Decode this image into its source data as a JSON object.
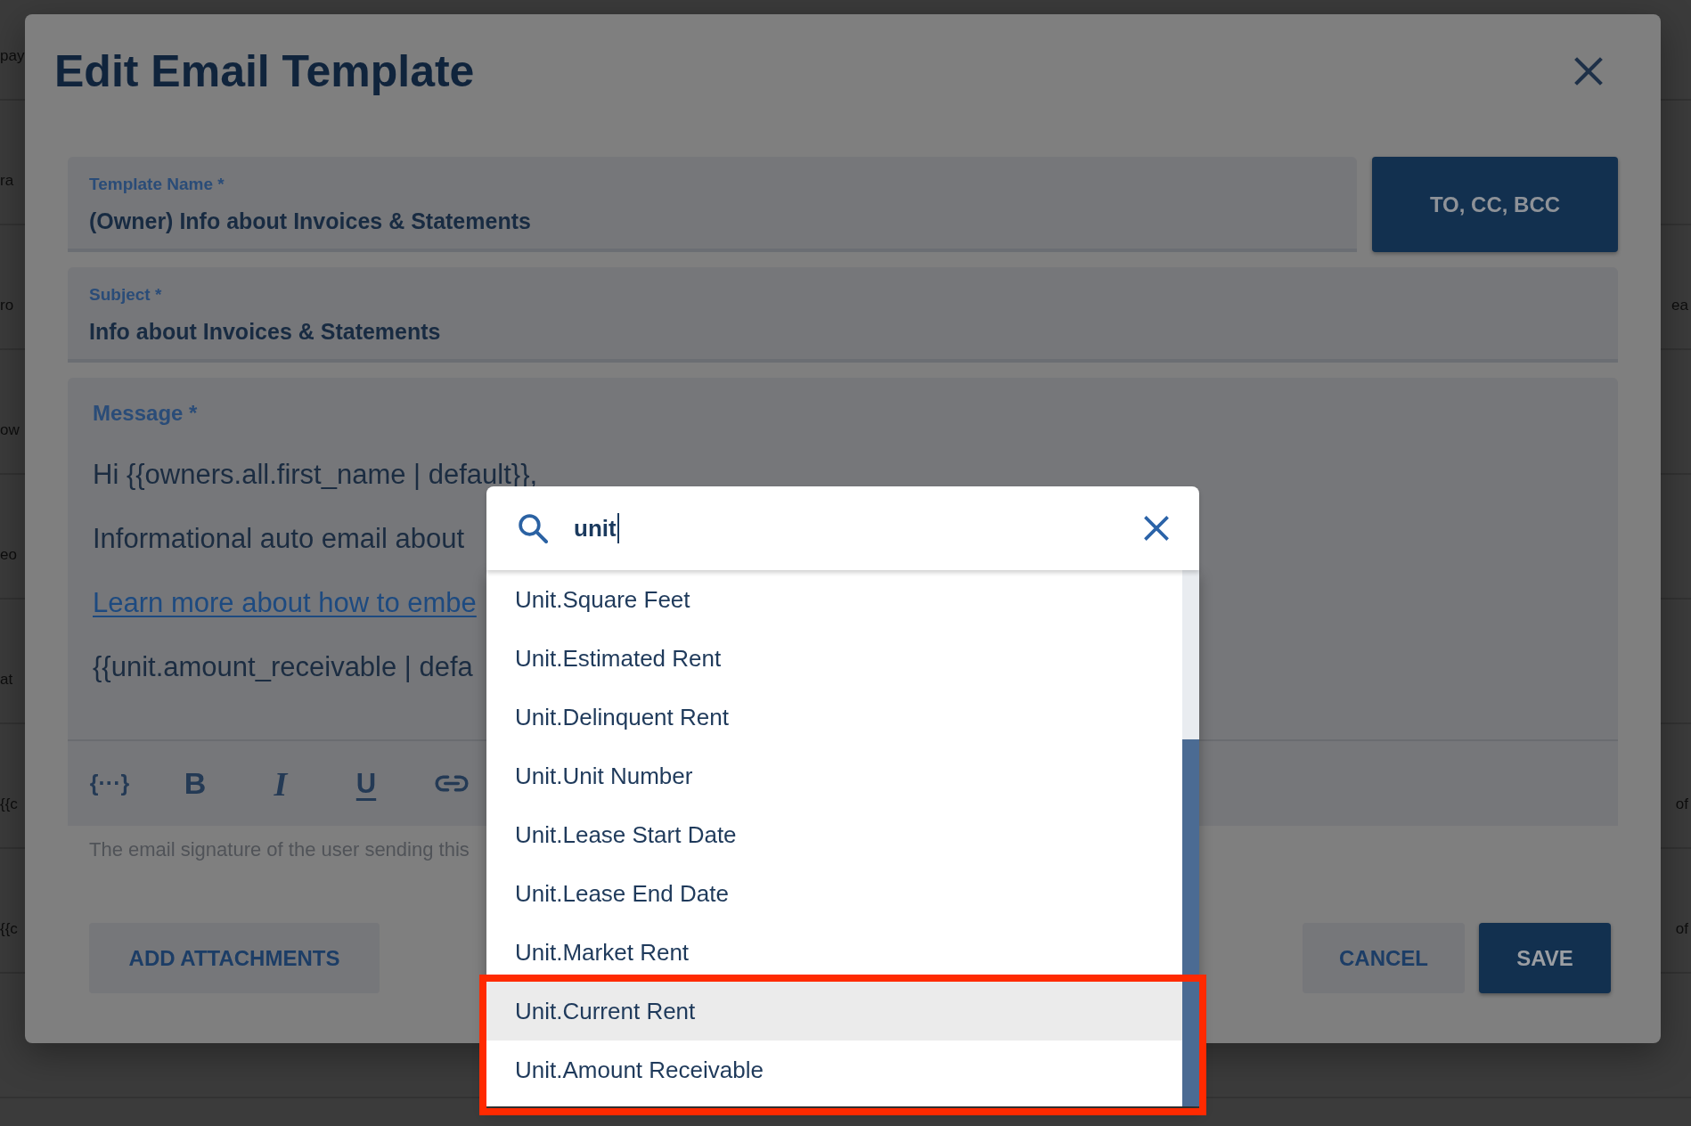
{
  "background_page": {
    "rows": [
      {
        "left_text": "pay"
      },
      {
        "left_text": "ra"
      },
      {
        "left_text": "ro",
        "right_text": "ea"
      },
      {
        "left_text": "ow"
      },
      {
        "left_text": "eo"
      },
      {
        "left_text": "at"
      },
      {
        "left_text": "{{c",
        "right_text": "of"
      },
      {
        "left_text": "{{c",
        "right_text": "of"
      }
    ]
  },
  "dialog": {
    "title": "Edit Email Template",
    "template_name": {
      "label": "Template Name *",
      "value": "(Owner) Info about Invoices & Statements"
    },
    "recipients_button": "TO, CC, BCC",
    "subject": {
      "label": "Subject *",
      "value": "Info about Invoices & Statements"
    },
    "message": {
      "label": "Message *",
      "paragraphs": [
        {
          "kind": "text",
          "text": "Hi {{owners.all.first_name | default}},"
        },
        {
          "kind": "text",
          "text": "Informational auto email about"
        },
        {
          "kind": "link",
          "text": "Learn more about how to embe"
        },
        {
          "kind": "text",
          "text": "{{unit.amount_receivable | defa"
        }
      ],
      "toolbar": [
        {
          "kind": "glyph",
          "label": "{···}"
        },
        {
          "kind": "bold",
          "label": "B"
        },
        {
          "kind": "italic",
          "label": "I"
        },
        {
          "kind": "underline",
          "label": "U"
        },
        {
          "kind": "link"
        }
      ]
    },
    "signature_note": "The email signature of the user sending this",
    "attachments_button": "ADD ATTACHMENTS",
    "actions": [
      {
        "kind": "secondary",
        "label": "CANCEL"
      },
      {
        "kind": "primary",
        "label": "SAVE"
      }
    ]
  },
  "variable_picker": {
    "search": {
      "value": "unit"
    },
    "items": [
      {
        "label": "Unit.Square Feet",
        "selected": false,
        "framed": false
      },
      {
        "label": "Unit.Estimated Rent",
        "selected": false,
        "framed": false
      },
      {
        "label": "Unit.Delinquent Rent",
        "selected": false,
        "framed": false
      },
      {
        "label": "Unit.Unit Number",
        "selected": false,
        "framed": false
      },
      {
        "label": "Unit.Lease Start Date",
        "selected": false,
        "framed": false
      },
      {
        "label": "Unit.Lease End Date",
        "selected": false,
        "framed": false
      },
      {
        "label": "Unit.Market Rent",
        "selected": false,
        "framed": false
      },
      {
        "label": "Unit.Current Rent",
        "selected": true,
        "framed": true
      },
      {
        "label": "Unit.Amount Receivable",
        "selected": false,
        "framed": true
      }
    ]
  }
}
